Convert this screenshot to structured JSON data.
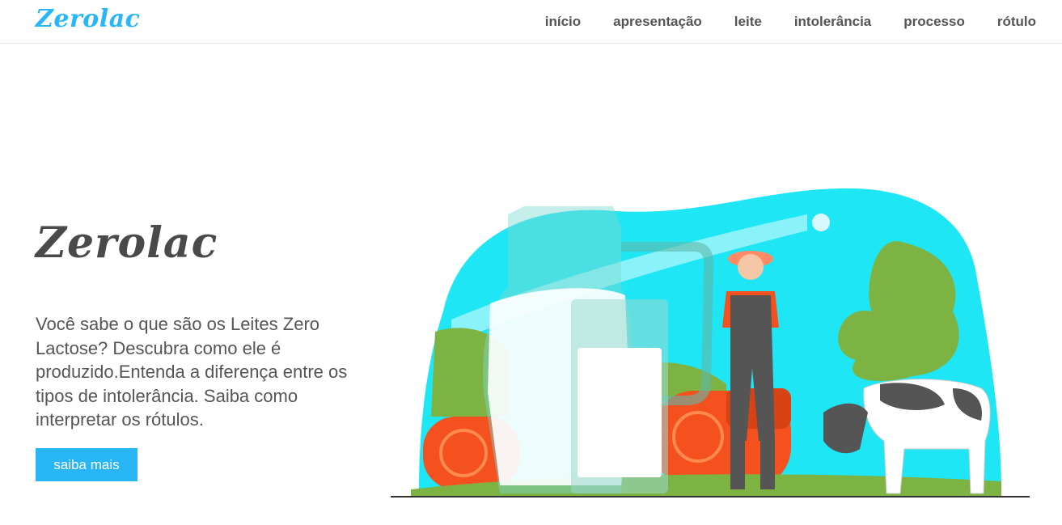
{
  "navbar": {
    "brand": "Zerolac",
    "links": [
      "início",
      "apresentação",
      "leite",
      "intolerância",
      "processo",
      "rótulo"
    ]
  },
  "hero": {
    "title": "Zerolac",
    "text": "Você sabe o que são os Leites Zero Lactose? Descubra como ele é produzido.Entenda a diferença entre os tipos de intolerância. Saiba como interpretar os rótulos.",
    "button_label": "saiba mais"
  },
  "colors": {
    "accent": "#29b6f6",
    "text": "#555555",
    "sky": "#1fe0f0",
    "grass": "#7cb342",
    "hay": "#f4511e"
  },
  "icons": [
    "milk-illustration"
  ]
}
